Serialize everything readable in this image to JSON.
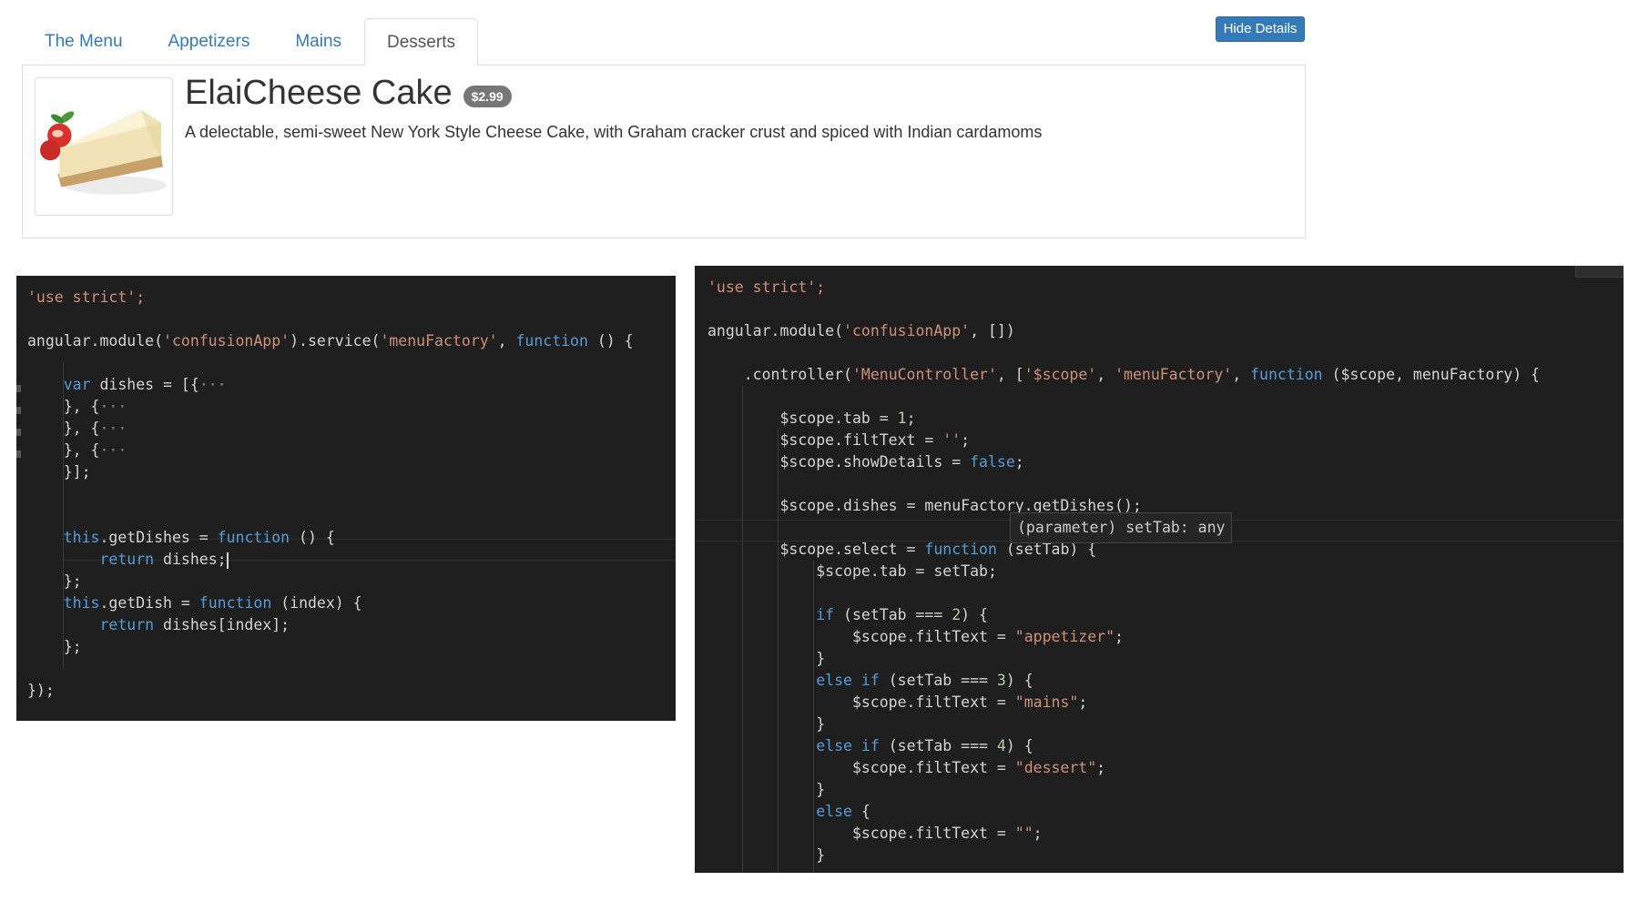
{
  "nav": {
    "tabs": [
      {
        "label": "The Menu",
        "active": false
      },
      {
        "label": "Appetizers",
        "active": false
      },
      {
        "label": "Mains",
        "active": false
      },
      {
        "label": "Desserts",
        "active": true
      }
    ],
    "hide_details_label": "Hide Details"
  },
  "dish": {
    "name": "ElaiCheese Cake",
    "price": "$2.99",
    "description": "A delectable, semi-sweet New York Style Cheese Cake, with Graham cracker crust and spiced with Indian cardamoms",
    "image_alt": "cheesecake slice"
  },
  "colors": {
    "link": "#337ab7",
    "editor_bg": "#1e1e1e",
    "keyword": "#569cd6",
    "string": "#ce9178",
    "number": "#b5cea8",
    "text": "#d4d4d4"
  },
  "code_left": {
    "lines": [
      "'use strict';",
      "",
      "angular.module('confusionApp').service('menuFactory', function () {",
      "",
      "    var dishes = [{···",
      "    }, {···",
      "    }, {···",
      "    }, {···",
      "    }];",
      "",
      "",
      "    this.getDishes = function () {",
      "        return dishes;",
      "    };",
      "    this.getDish = function (index) {",
      "        return dishes[index];",
      "    };",
      "",
      "});"
    ]
  },
  "code_right": {
    "lines": [
      "'use strict';",
      "",
      "angular.module('confusionApp', [])",
      "",
      "    .controller('MenuController', ['$scope', 'menuFactory', function ($scope, menuFactory) {",
      "",
      "        $scope.tab = 1;",
      "        $scope.filtText = '';",
      "        $scope.showDetails = false;",
      "",
      "        $scope.dishes = menuFactory.getDishes();",
      "",
      "        $scope.select = function (setTab) {",
      "            $scope.tab = setTab;",
      "",
      "            if (setTab === 2) {",
      "                $scope.filtText = \"appetizer\";",
      "            }",
      "            else if (setTab === 3) {",
      "                $scope.filtText = \"mains\";",
      "            }",
      "            else if (setTab === 4) {",
      "                $scope.filtText = \"dessert\";",
      "            }",
      "            else {",
      "                $scope.filtText = \"\";",
      "            }"
    ],
    "hover_tooltip": "(parameter) setTab: any"
  }
}
